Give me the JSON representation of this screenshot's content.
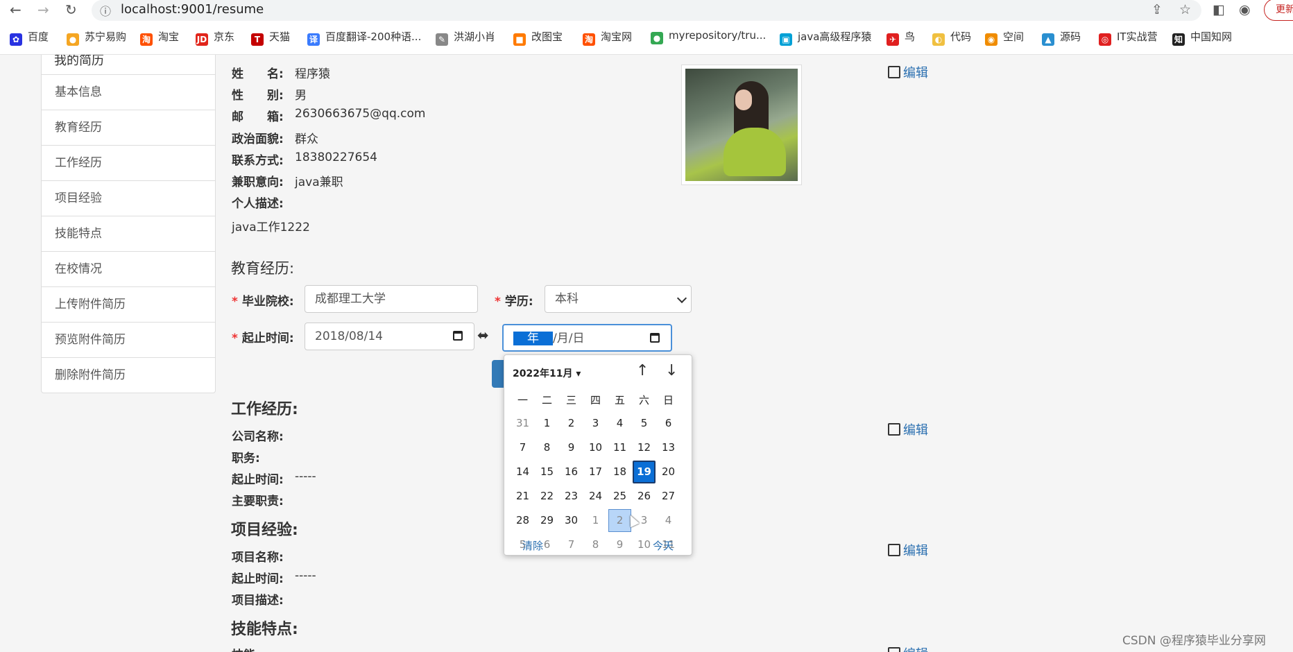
{
  "browser": {
    "url": "localhost:9001/resume",
    "update_label": "更新",
    "bookmarks": [
      {
        "label": "百度",
        "color": "#2932e1",
        "glyph": "✿"
      },
      {
        "label": "苏宁易购",
        "color": "#f5a623",
        "glyph": "●"
      },
      {
        "label": "淘宝",
        "color": "#ff5000",
        "glyph": "淘"
      },
      {
        "label": "京东",
        "color": "#e1251b",
        "glyph": "JD"
      },
      {
        "label": "天猫",
        "color": "#c40000",
        "glyph": "T"
      },
      {
        "label": "百度翻译-200种语...",
        "color": "#3a7bfd",
        "glyph": "译"
      },
      {
        "label": "洪湖小肖",
        "color": "#888888",
        "glyph": "✎"
      },
      {
        "label": "改图宝",
        "color": "#ff7a00",
        "glyph": "■"
      },
      {
        "label": "淘宝网",
        "color": "#ff5000",
        "glyph": "淘"
      },
      {
        "label": "myrepository/tru...",
        "color": "#34a853",
        "glyph": "●"
      },
      {
        "label": "java高级程序猿",
        "color": "#00a1d6",
        "glyph": "▣"
      },
      {
        "label": "鸟",
        "color": "#e02020",
        "glyph": "✈"
      },
      {
        "label": "代码",
        "color": "#f0c040",
        "glyph": "◐"
      },
      {
        "label": "空间",
        "color": "#f08c00",
        "glyph": "◉"
      },
      {
        "label": "源码",
        "color": "#2a8fd0",
        "glyph": "▲"
      },
      {
        "label": "IT实战营",
        "color": "#e02020",
        "glyph": "◎"
      },
      {
        "label": "中国知网",
        "color": "#222222",
        "glyph": "知"
      }
    ]
  },
  "sidebar": {
    "header": "我的简历",
    "items": [
      "基本信息",
      "教育经历",
      "工作经历",
      "项目经验",
      "技能特点",
      "在校情况",
      "上传附件简历",
      "预览附件简历",
      "删除附件简历"
    ]
  },
  "basic": {
    "edit_label": "编辑",
    "fields": [
      {
        "label": "姓　　名:",
        "value": "程序猿"
      },
      {
        "label": "性　　别:",
        "value": "男"
      },
      {
        "label": "邮　　箱:",
        "value": "2630663675@qq.com"
      },
      {
        "label": "政治面貌:",
        "value": "群众"
      },
      {
        "label": "联系方式:",
        "value": "18380227654"
      },
      {
        "label": "兼职意向:",
        "value": "java兼职"
      },
      {
        "label": "个人描述:",
        "value": ""
      }
    ],
    "description": "java工作1222"
  },
  "education": {
    "title": "教育经历:",
    "school_label": "毕业院校:",
    "school_value": "成都理工大学",
    "degree_label": "学历:",
    "degree_value": "本科",
    "period_label": "起止时间:",
    "start_date": "2018/08/14",
    "end_placeholder_year": "年",
    "end_placeholder_rest": "/月/日",
    "arrow": "⬌"
  },
  "datepicker": {
    "month_label": "2022年11月",
    "weekdays": [
      "一",
      "二",
      "三",
      "四",
      "五",
      "六",
      "日"
    ],
    "weeks": [
      [
        {
          "d": "31",
          "dim": true
        },
        {
          "d": "1"
        },
        {
          "d": "2"
        },
        {
          "d": "3"
        },
        {
          "d": "4"
        },
        {
          "d": "5"
        },
        {
          "d": "6"
        }
      ],
      [
        {
          "d": "7"
        },
        {
          "d": "8"
        },
        {
          "d": "9"
        },
        {
          "d": "10"
        },
        {
          "d": "11"
        },
        {
          "d": "12"
        },
        {
          "d": "13"
        }
      ],
      [
        {
          "d": "14"
        },
        {
          "d": "15"
        },
        {
          "d": "16"
        },
        {
          "d": "17"
        },
        {
          "d": "18"
        },
        {
          "d": "19",
          "today": true
        },
        {
          "d": "20"
        }
      ],
      [
        {
          "d": "21"
        },
        {
          "d": "22"
        },
        {
          "d": "23"
        },
        {
          "d": "24"
        },
        {
          "d": "25"
        },
        {
          "d": "26"
        },
        {
          "d": "27"
        }
      ],
      [
        {
          "d": "28"
        },
        {
          "d": "29"
        },
        {
          "d": "30"
        },
        {
          "d": "1",
          "dim": true
        },
        {
          "d": "2",
          "dim": true,
          "hover": true
        },
        {
          "d": "3",
          "dim": true
        },
        {
          "d": "4",
          "dim": true
        }
      ],
      [
        {
          "d": "5",
          "dim": true
        },
        {
          "d": "6",
          "dim": true
        },
        {
          "d": "7",
          "dim": true
        },
        {
          "d": "8",
          "dim": true
        },
        {
          "d": "9",
          "dim": true
        },
        {
          "d": "10",
          "dim": true
        },
        {
          "d": "11",
          "dim": true
        }
      ]
    ],
    "clear_label": "清除",
    "today_label": "今天"
  },
  "work": {
    "title": "工作经历:",
    "edit_label": "编辑",
    "fields": [
      {
        "label": "公司名称:",
        "value": ""
      },
      {
        "label": "职务:",
        "value": ""
      },
      {
        "label": "起止时间:",
        "value": "-----"
      },
      {
        "label": "主要职责:",
        "value": ""
      }
    ]
  },
  "project": {
    "title": "项目经验:",
    "edit_label": "编辑",
    "fields": [
      {
        "label": "项目名称:",
        "value": ""
      },
      {
        "label": "起止时间:",
        "value": "-----"
      },
      {
        "label": "项目描述:",
        "value": ""
      }
    ]
  },
  "skills": {
    "title": "技能特点:",
    "edit_label": "编辑",
    "first_label": "技能"
  },
  "watermark": "CSDN @程序猿毕业分享网"
}
